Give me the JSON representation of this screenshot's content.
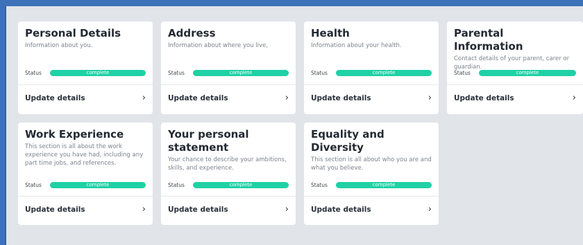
{
  "cards": [
    {
      "title": "Personal Details",
      "description": "Information about you.",
      "status_label": "Status",
      "status_value": "complete",
      "action_label": "Update details"
    },
    {
      "title": "Address",
      "description": "Information about where you live,",
      "status_label": "Status",
      "status_value": "complete",
      "action_label": "Update details"
    },
    {
      "title": "Health",
      "description": "Information about your health.",
      "status_label": "Status",
      "status_value": "complete",
      "action_label": "Update details"
    },
    {
      "title": "Parental Information",
      "description": "Contact details of your parent, carer or guardian.",
      "status_label": "Status",
      "status_value": "complete",
      "action_label": "Update details"
    },
    {
      "title": "Work Experience",
      "description": "This section is all about the work experience you have had, including any part time jobs, and references.",
      "status_label": "Status",
      "status_value": "complete",
      "action_label": "Update details"
    },
    {
      "title": "Your personal statement",
      "description": "Your chance to describe your ambitions, skills, and experience.",
      "status_label": "Status",
      "status_value": "complete",
      "action_label": "Update details"
    },
    {
      "title": "Equality and Diversity",
      "description": "This section is all about who you are and what you believe.",
      "status_label": "Status",
      "status_value": "complete",
      "action_label": "Update details"
    }
  ],
  "colors": {
    "outer_background": "#3d72b9",
    "panel_background": "#e1e4e9",
    "card_background": "#ffffff",
    "status_complete": "#1fd1a5"
  },
  "icons": {
    "action": "chevron-right-icon"
  }
}
